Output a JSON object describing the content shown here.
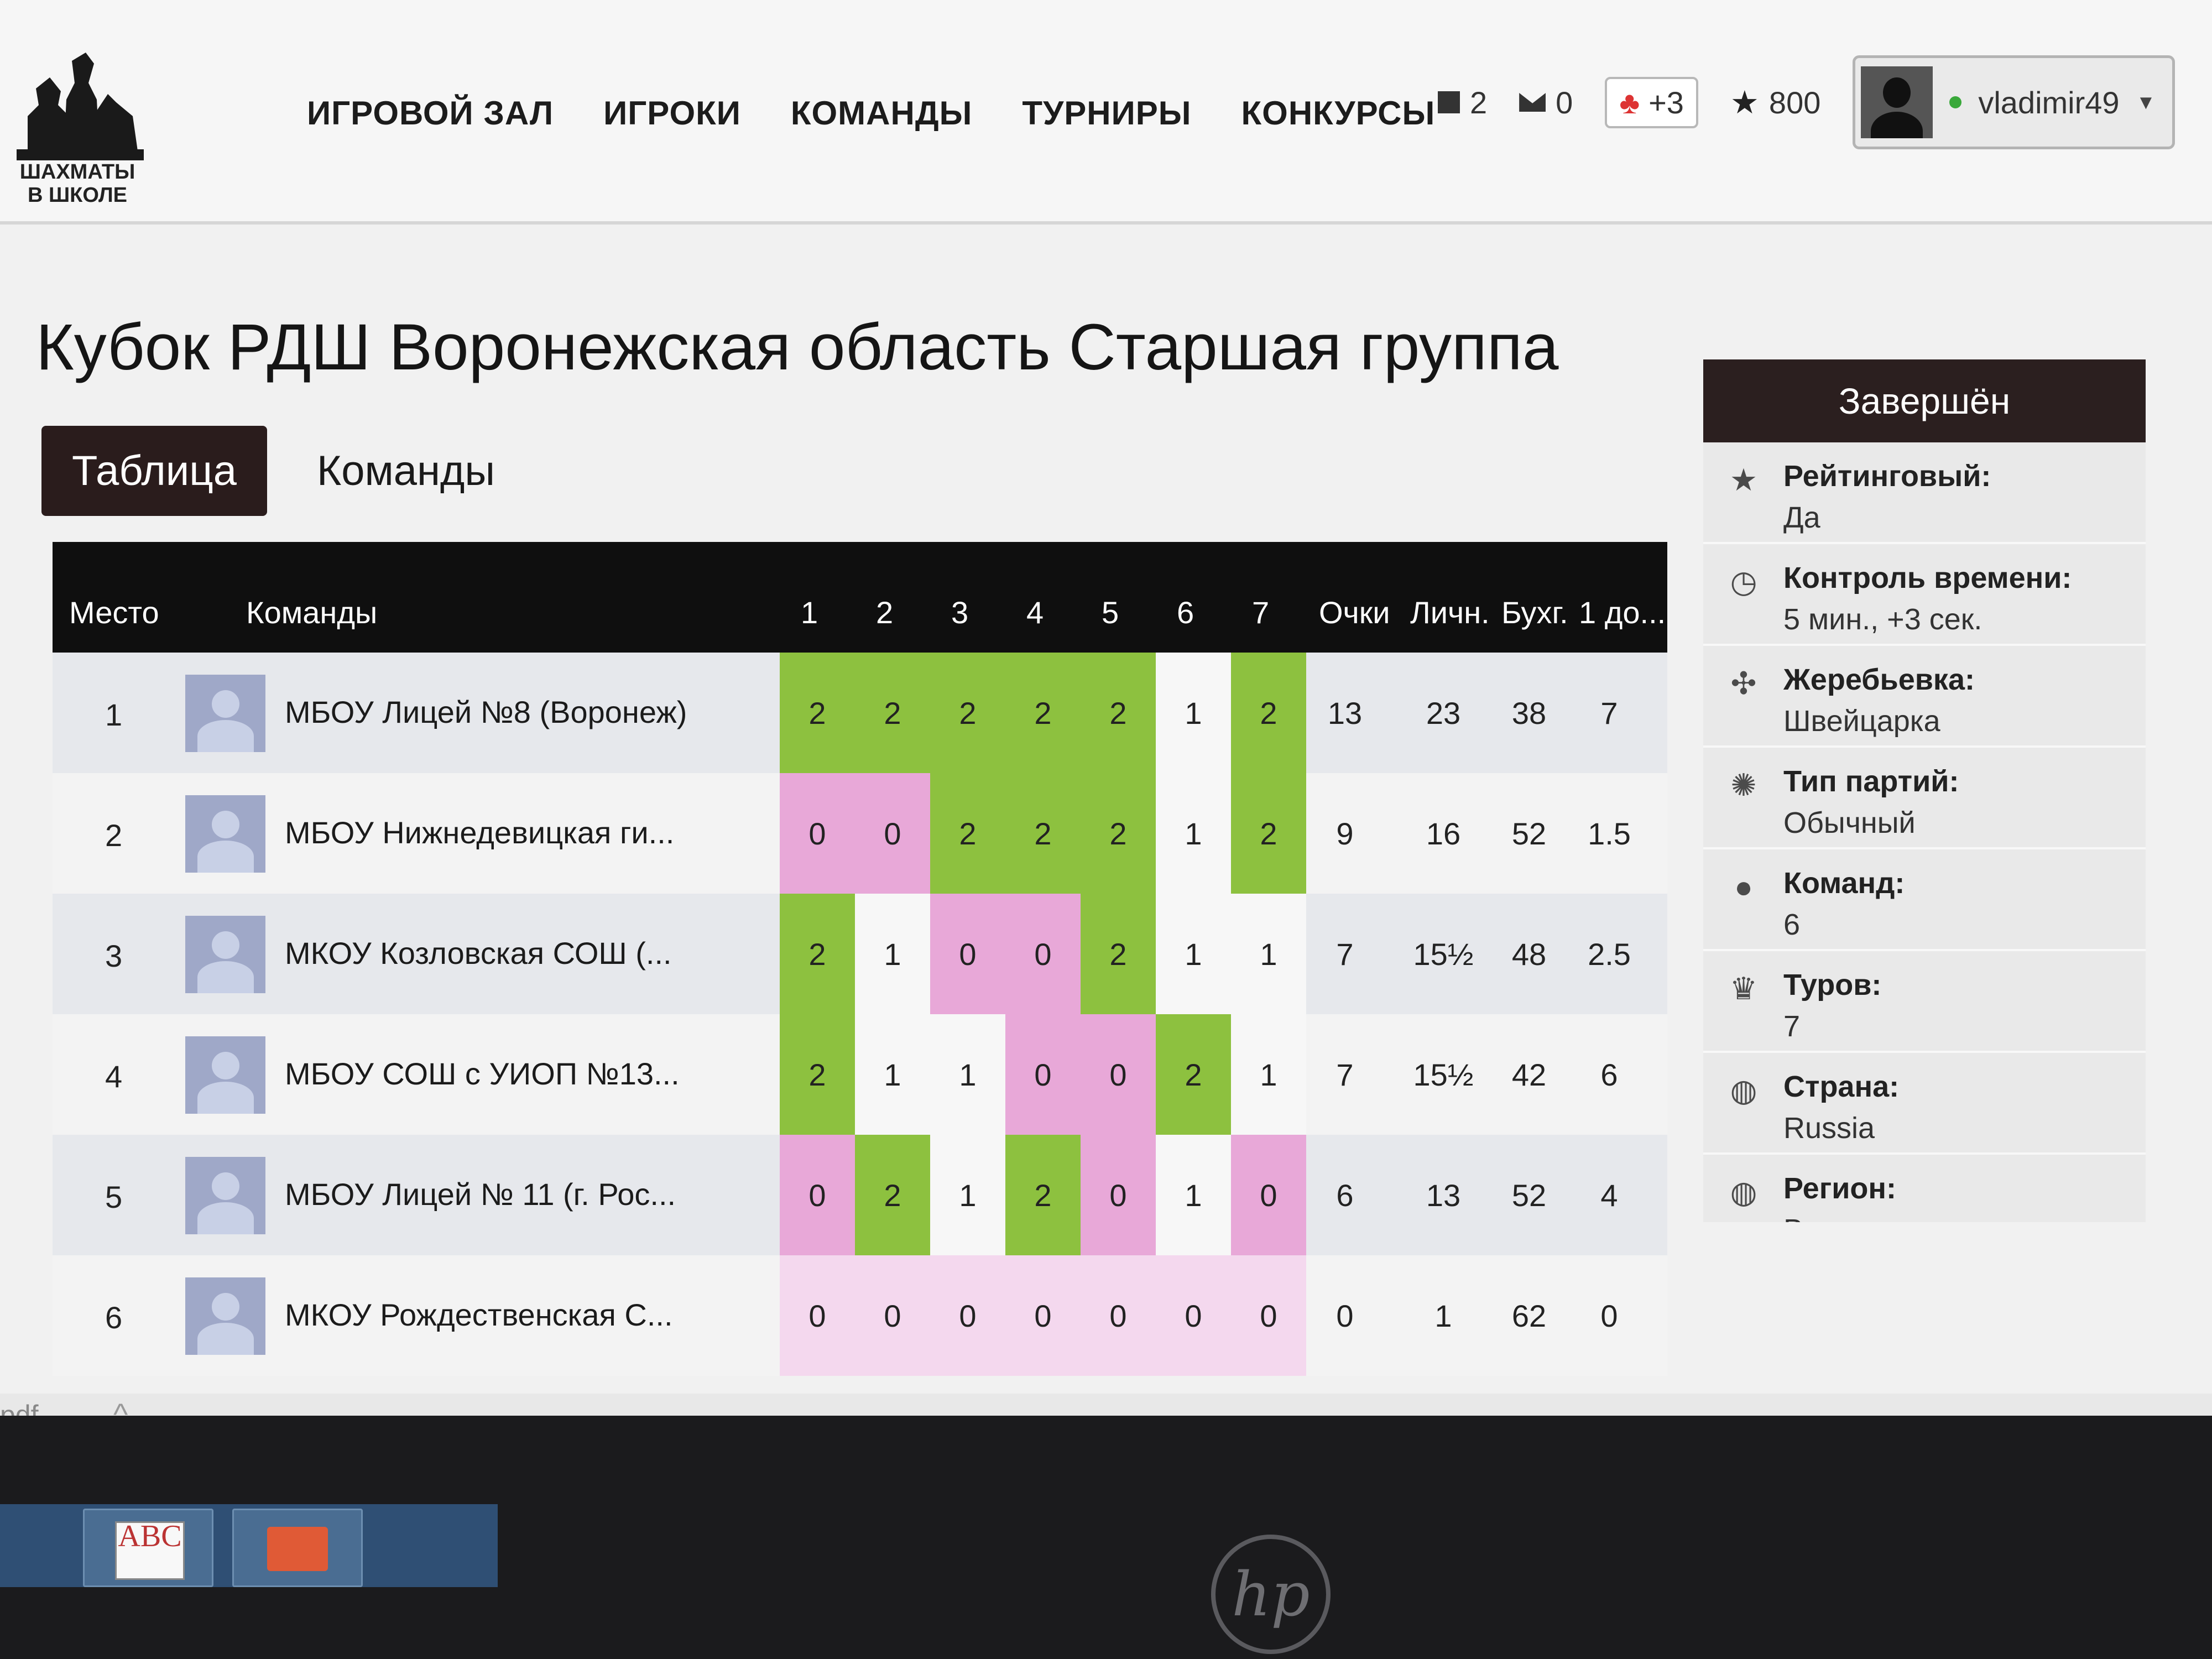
{
  "logo": {
    "text_line1": "ШАХМАТЫ",
    "text_line2": "В ШКОЛЕ"
  },
  "nav": [
    "ИГРОВОЙ ЗАЛ",
    "ИГРОКИ",
    "КОМАНДЫ",
    "ТУРНИРЫ",
    "КОНКУРСЫ"
  ],
  "header": {
    "games_count": "2",
    "messages_count": "0",
    "friends_badge": "+3",
    "rating": "800",
    "username": "vladimir49"
  },
  "page_title": "Кубок РДШ Воронежская область Старшая группа",
  "tabs": {
    "active": "Таблица",
    "other": "Команды"
  },
  "standings": {
    "columns": [
      "Место",
      "Команды",
      "1",
      "2",
      "3",
      "4",
      "5",
      "6",
      "7",
      "Очки",
      "Личн.",
      "Бухг.",
      "1 до..."
    ],
    "rows": [
      {
        "place": "1",
        "team": "МБОУ Лицей №8 (Воронеж)",
        "rounds": [
          "2",
          "2",
          "2",
          "2",
          "2",
          "1",
          "2"
        ],
        "results": [
          "win",
          "win",
          "win",
          "win",
          "win",
          "draw",
          "win"
        ],
        "points": "13",
        "personal": "23",
        "buchholz": "38",
        "extra": "7"
      },
      {
        "place": "2",
        "team": "МБОУ Нижнедевицкая ги...",
        "rounds": [
          "0",
          "0",
          "2",
          "2",
          "2",
          "1",
          "2"
        ],
        "results": [
          "loss",
          "loss",
          "win",
          "win",
          "win",
          "draw",
          "win"
        ],
        "points": "9",
        "personal": "16",
        "buchholz": "52",
        "extra": "1.5"
      },
      {
        "place": "3",
        "team": "МКОУ Козловская СОШ (...",
        "rounds": [
          "2",
          "1",
          "0",
          "0",
          "2",
          "1",
          "1"
        ],
        "results": [
          "win",
          "draw",
          "loss",
          "loss",
          "win",
          "draw",
          "draw"
        ],
        "points": "7",
        "personal": "15½",
        "buchholz": "48",
        "extra": "2.5"
      },
      {
        "place": "4",
        "team": "МБОУ СОШ с УИОП №13...",
        "rounds": [
          "2",
          "1",
          "1",
          "0",
          "0",
          "2",
          "1"
        ],
        "results": [
          "win",
          "draw",
          "draw",
          "loss",
          "loss",
          "win",
          "draw"
        ],
        "points": "7",
        "personal": "15½",
        "buchholz": "42",
        "extra": "6"
      },
      {
        "place": "5",
        "team": "МБОУ Лицей № 11 (г. Рос...",
        "rounds": [
          "0",
          "2",
          "1",
          "2",
          "0",
          "1",
          "0"
        ],
        "results": [
          "loss",
          "win",
          "draw",
          "win",
          "loss",
          "draw",
          "loss"
        ],
        "points": "6",
        "personal": "13",
        "buchholz": "52",
        "extra": "4"
      },
      {
        "place": "6",
        "team": "МКОУ Рождественская С...",
        "rounds": [
          "0",
          "0",
          "0",
          "0",
          "0",
          "0",
          "0"
        ],
        "results": [
          "none",
          "none",
          "none",
          "none",
          "none",
          "none",
          "none"
        ],
        "points": "0",
        "personal": "1",
        "buchholz": "62",
        "extra": "0"
      }
    ]
  },
  "side_panel": {
    "status": "Завершён",
    "items": [
      {
        "icon": "star-icon",
        "label": "Рейтинговый:",
        "value": "Да"
      },
      {
        "icon": "clock-icon",
        "label": "Контроль времени:",
        "value": "5 мин., +3 сек."
      },
      {
        "icon": "puzzle-icon",
        "label": "Жеребьевка:",
        "value": "Швейцарка"
      },
      {
        "icon": "gear-icon",
        "label": "Тип партий:",
        "value": "Обычный"
      },
      {
        "icon": "user-icon",
        "label": "Команд:",
        "value": "6"
      },
      {
        "icon": "trophy-icon",
        "label": "Туров:",
        "value": "7"
      },
      {
        "icon": "globe-icon",
        "label": "Страна:",
        "value": "Russia"
      },
      {
        "icon": "globe-icon",
        "label": "Регион:",
        "value": "Воронежская"
      }
    ]
  },
  "downloads": {
    "file_label": "pdf"
  },
  "taskbar": {
    "abc_icon": "ABC"
  },
  "bezel": {
    "brand": "hp"
  },
  "colors": {
    "win": "#8dc13f",
    "loss": "#e8a8d8",
    "header_dark": "#2b1f1f"
  }
}
